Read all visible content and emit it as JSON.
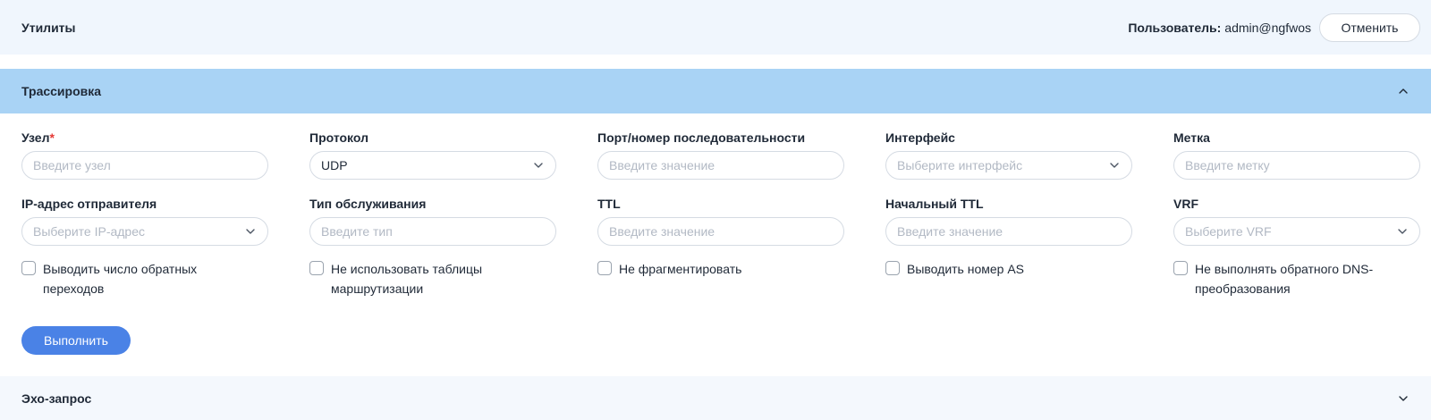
{
  "header": {
    "title": "Утилиты",
    "user_label": "Пользователь:",
    "user_value": "admin@ngfwos",
    "cancel_label": "Отменить"
  },
  "traceroute": {
    "title": "Трассировка",
    "expanded_icon": "chevron-up-icon",
    "fields": {
      "host": {
        "label": "Узел",
        "required_mark": "*",
        "placeholder": "Введите узел"
      },
      "protocol": {
        "label": "Протокол",
        "value": "UDP"
      },
      "port": {
        "label": "Порт/номер последовательности",
        "placeholder": "Введите значение"
      },
      "interface": {
        "label": "Интерфейс",
        "placeholder": "Выберите интерфейс"
      },
      "tag": {
        "label": "Метка",
        "placeholder": "Введите метку"
      },
      "source_ip": {
        "label": "IP-адрес отправителя",
        "placeholder": "Выберите IP-адрес"
      },
      "tos": {
        "label": "Тип обслуживания",
        "placeholder": "Введите тип"
      },
      "ttl": {
        "label": "TTL",
        "placeholder": "Введите значение"
      },
      "initial_ttl": {
        "label": "Начальный TTL",
        "placeholder": "Введите значение"
      },
      "vrf": {
        "label": "VRF",
        "placeholder": "Выберите VRF"
      }
    },
    "checkboxes": {
      "show_hops": {
        "label": "Выводить число обратных переходов",
        "checked": false
      },
      "no_routing": {
        "label": "Не использовать таблицы маршрутизации",
        "checked": false
      },
      "no_fragment": {
        "label": "Не фрагментировать",
        "checked": false
      },
      "show_as": {
        "label": "Выводить номер AS",
        "checked": false
      },
      "no_dns": {
        "label": "Не выполнять обратного DNS-преобразования",
        "checked": false
      }
    },
    "run_label": "Выполнить"
  },
  "ping": {
    "title": "Эхо-запрос",
    "collapsed_icon": "chevron-down-icon"
  },
  "colors": {
    "accent": "#4a82e6",
    "section_header": "#a9d3f5",
    "topbar_bg": "#f0f6fd",
    "required": "#e53935"
  }
}
